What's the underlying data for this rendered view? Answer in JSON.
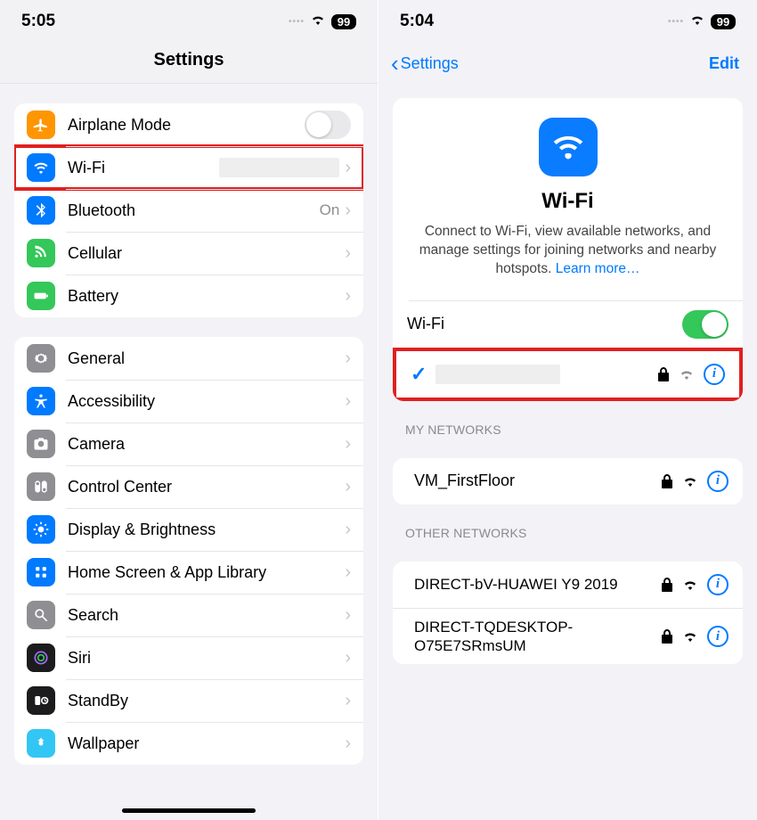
{
  "left": {
    "status": {
      "time": "5:05",
      "battery": "99"
    },
    "title": "Settings",
    "rows": {
      "airplane": "Airplane Mode",
      "wifi": "Wi-Fi",
      "bluetooth": "Bluetooth",
      "bluetooth_value": "On",
      "cellular": "Cellular",
      "battery": "Battery",
      "general": "General",
      "accessibility": "Accessibility",
      "camera": "Camera",
      "control_center": "Control Center",
      "display": "Display & Brightness",
      "home": "Home Screen & App Library",
      "search": "Search",
      "siri": "Siri",
      "standby": "StandBy",
      "wallpaper": "Wallpaper"
    }
  },
  "right": {
    "status": {
      "time": "5:04",
      "battery": "99"
    },
    "nav": {
      "back": "Settings",
      "edit": "Edit"
    },
    "hero": {
      "title": "Wi-Fi",
      "desc": "Connect to Wi-Fi, view available networks, and manage settings for joining networks and nearby hotspots. ",
      "learn": "Learn more…"
    },
    "wifi_toggle_label": "Wi-Fi",
    "sections": {
      "my": "MY NETWORKS",
      "other": "OTHER NETWORKS"
    },
    "my_networks": [
      {
        "name": "VM_FirstFloor"
      }
    ],
    "other_networks": [
      {
        "name": "DIRECT-bV-HUAWEI Y9 2019"
      },
      {
        "name": "DIRECT-TQDESKTOP-O75E7SRmsUM"
      }
    ]
  }
}
